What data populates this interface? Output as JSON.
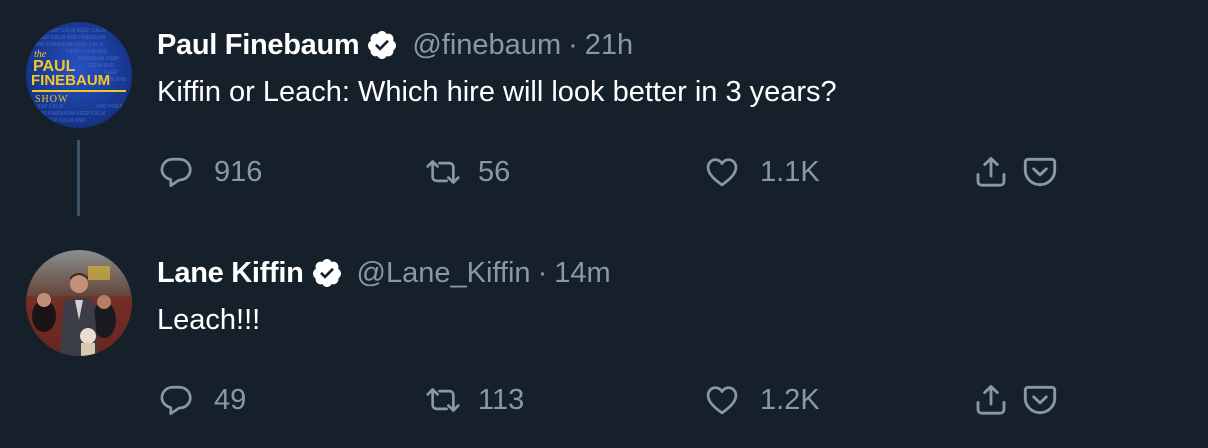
{
  "tweets": [
    {
      "avatar_text": {
        "line1": "the",
        "line2": "PAUL",
        "line3": "FINEBAUM",
        "line4": "SHOW"
      },
      "name": "Paul Finebaum",
      "handle": "@finebaum",
      "separator": "·",
      "time": "21h",
      "text": "Kiffin or Leach: Which hire will look better in 3 years?",
      "replies": "916",
      "retweets": "56",
      "likes": "1.1K"
    },
    {
      "name": "Lane Kiffin",
      "handle": "@Lane_Kiffin",
      "separator": "·",
      "time": "14m",
      "text": "Leach!!!",
      "replies": "49",
      "retweets": "113",
      "likes": "1.2K"
    }
  ],
  "colors": {
    "background": "#15202b",
    "primary_text": "#ffffff",
    "secondary_text": "#8899a6",
    "thread_line": "#3d5466",
    "avatar_blue": "#1c3d9a",
    "logo_yellow": "#f3c728"
  },
  "icons": [
    "verified-icon",
    "reply-icon",
    "retweet-icon",
    "like-icon",
    "share-icon",
    "pocket-icon"
  ]
}
